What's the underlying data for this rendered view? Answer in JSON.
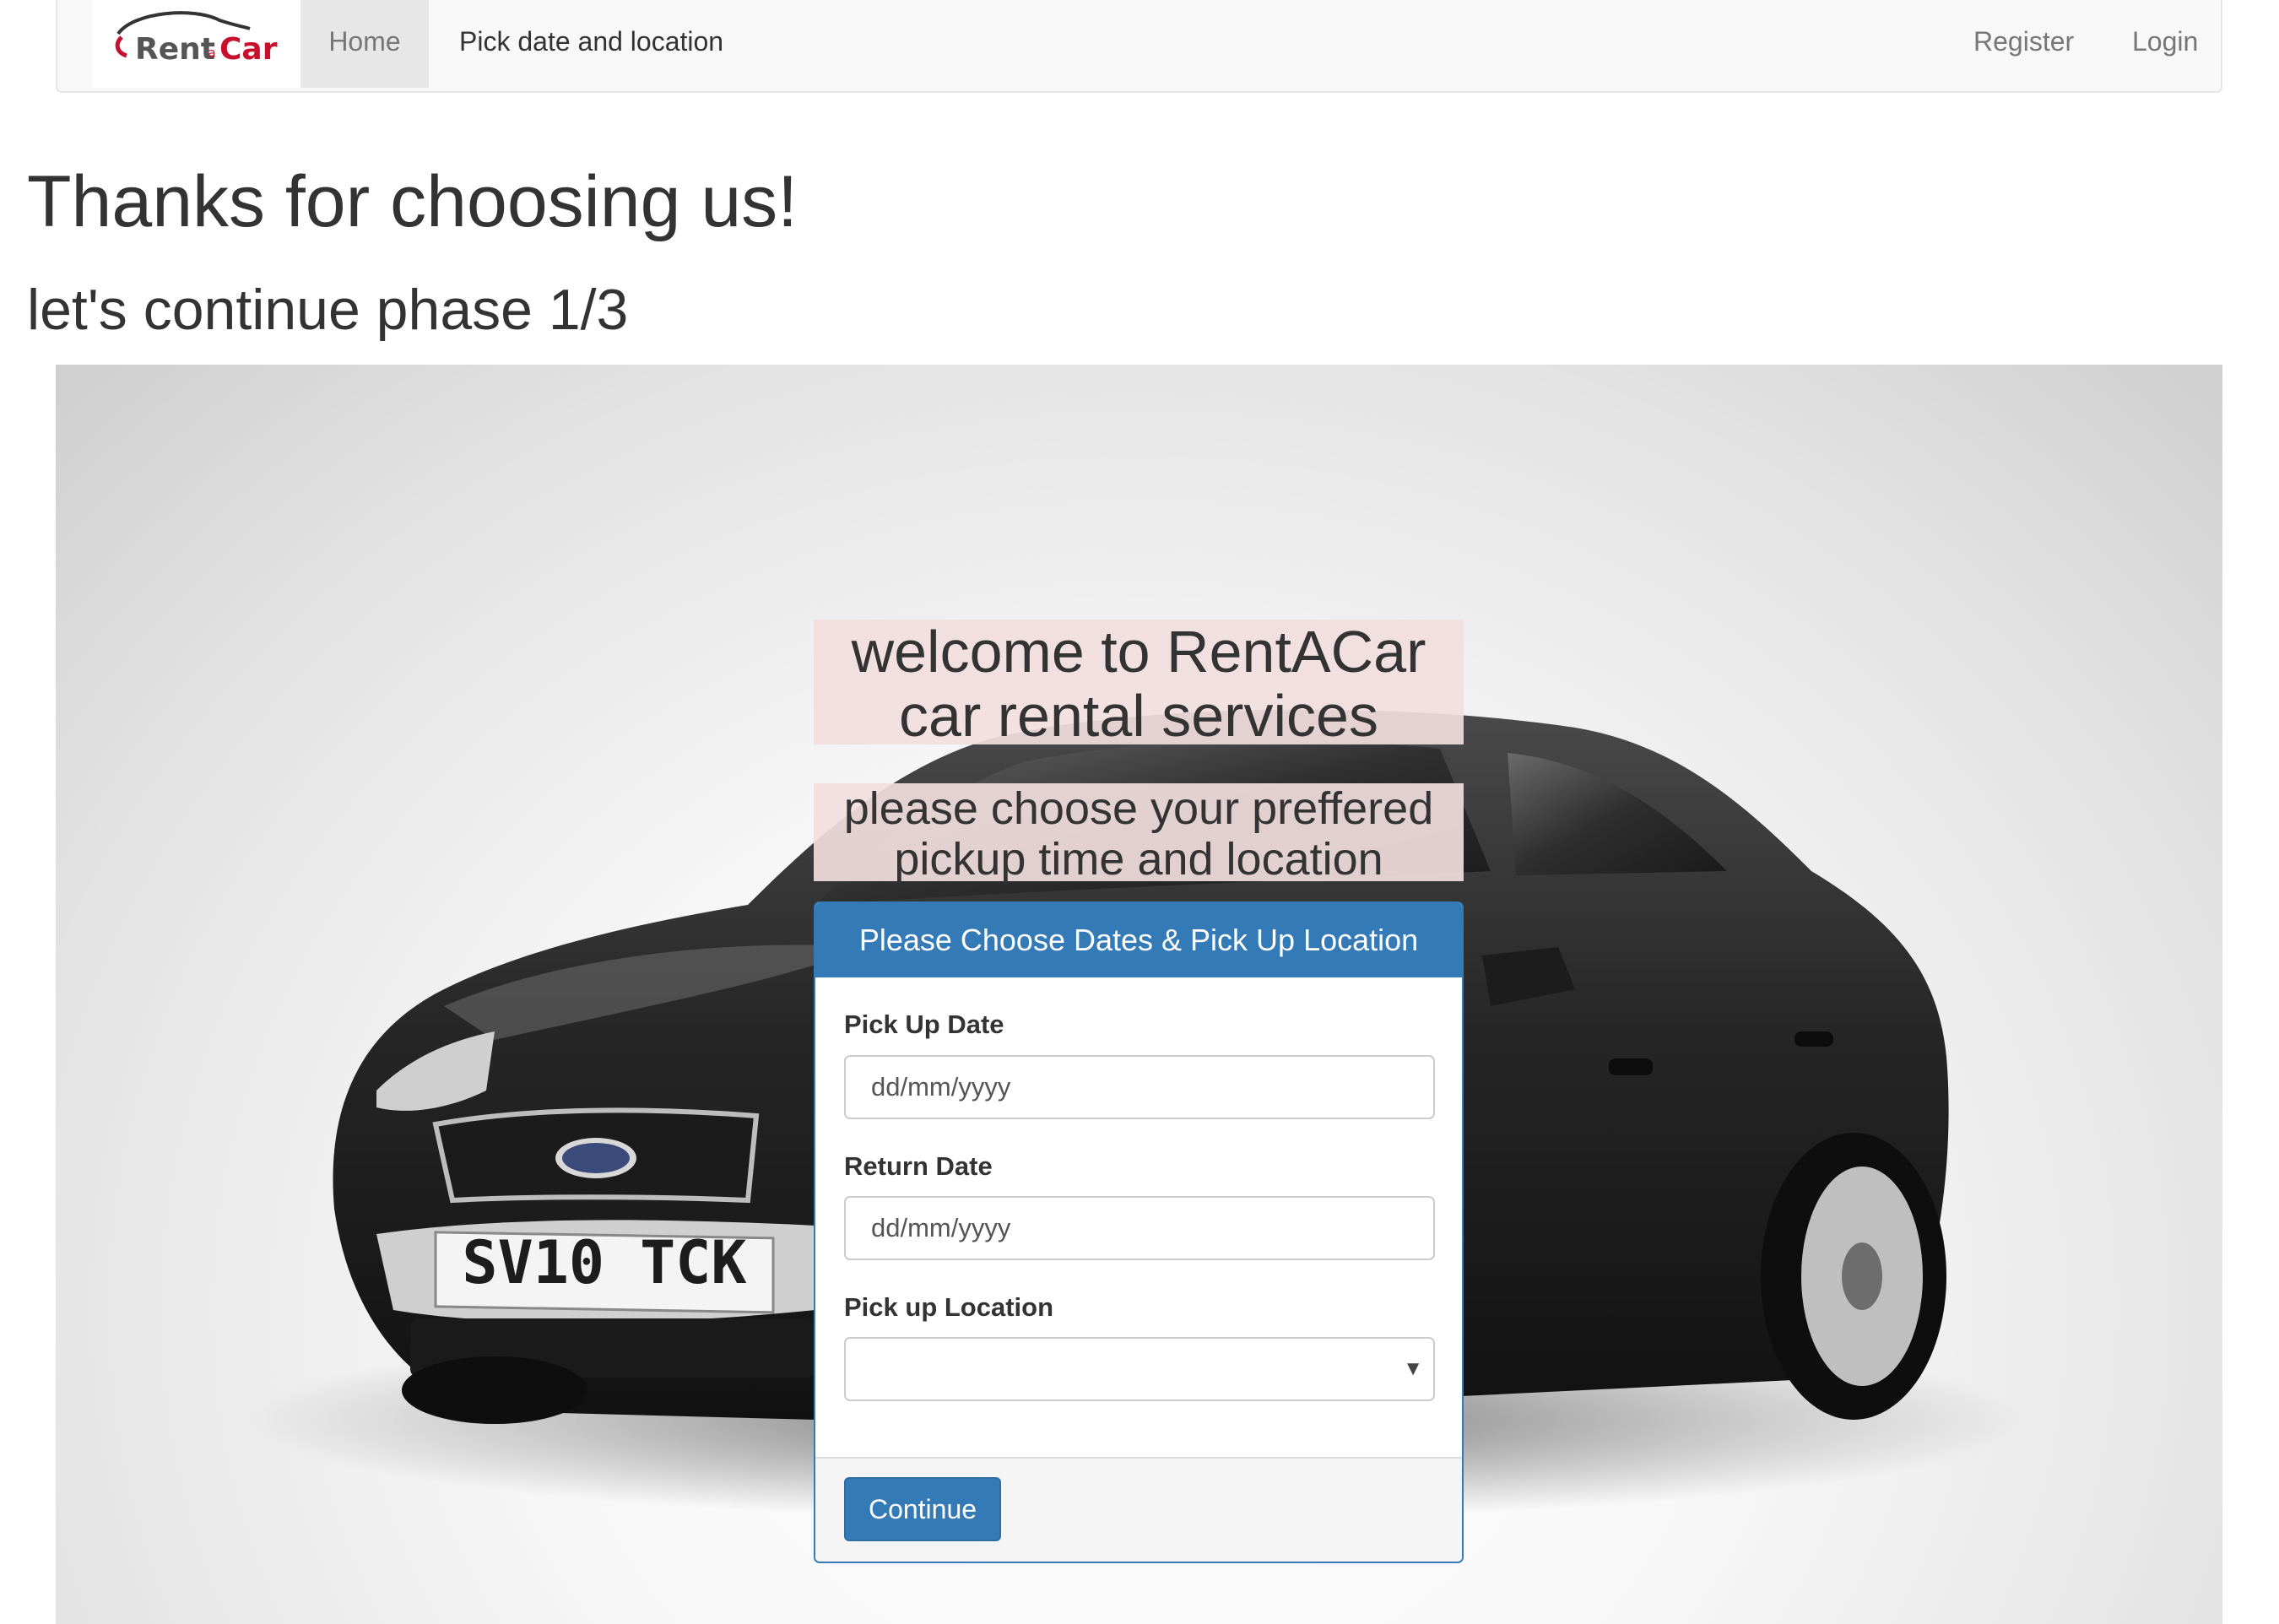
{
  "app": {
    "brand_logo_text": "RentaCar"
  },
  "navbar": {
    "home_label": "Home",
    "pick_label": "Pick date and location",
    "register_label": "Register",
    "login_label": "Login"
  },
  "page": {
    "title": "Thanks for choosing us!",
    "subtitle": "let's continue phase 1/3"
  },
  "hero": {
    "welcome_text": "welcome to RentACar car rental services",
    "choose_text": "please choose your preffered pickup time and location",
    "license_plate": "SV10 TCK"
  },
  "form": {
    "heading": "Please Choose Dates & Pick Up Location",
    "pickup_date_label": "Pick Up Date",
    "pickup_date_placeholder": "dd/mm/yyyy",
    "return_date_label": "Return Date",
    "return_date_placeholder": "dd/mm/yyyy",
    "location_label": "Pick up Location",
    "location_value": "",
    "continue_label": "Continue"
  },
  "colors": {
    "primary": "#337ab7",
    "banner_bg": "#f2dede",
    "navbar_bg": "#f8f8f8",
    "brand_red": "#c8102e"
  },
  "icons": {
    "select_arrow": "caret-down-icon",
    "logo": "car-outline-icon"
  }
}
